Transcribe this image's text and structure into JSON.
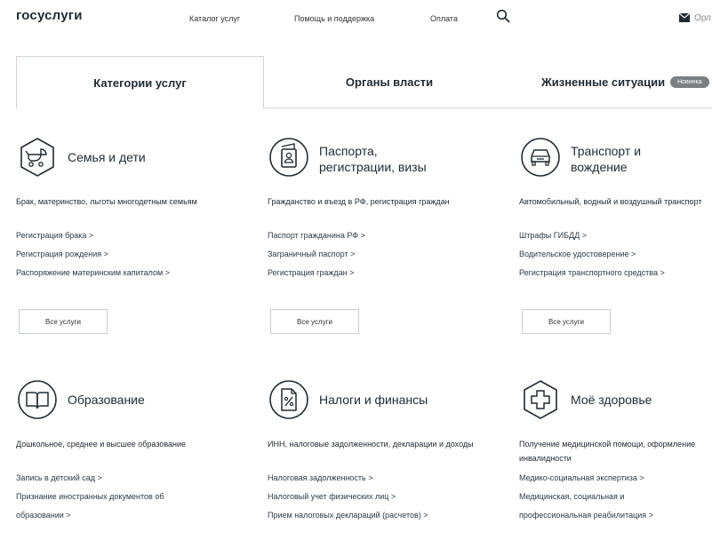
{
  "header": {
    "logo": "госуслуги",
    "nav_catalog": "Каталог услуг",
    "nav_help": "Помощь и поддержка",
    "nav_pay": "Оплата",
    "user_partial": "Орл"
  },
  "tabs": [
    {
      "label": "Категории услуг"
    },
    {
      "label": "Органы власти"
    },
    {
      "label": "Жизненные ситуации",
      "badge": "Новинка"
    }
  ],
  "categories": [
    {
      "title_line1": "Семья и дети",
      "desc": "Брак, материнство, льготы многодетным семьям",
      "links": [
        "Регистрация брака >",
        "Регистрация рождения >",
        "Распоряжение материнским капиталом >"
      ],
      "button": "Все услуги",
      "icon": "stroller-icon"
    },
    {
      "title_line1": "Паспорта,",
      "title_line2": "регистрации, визы",
      "desc": "Гражданство и въезд в РФ, регистрация граждан",
      "links": [
        "Паспорт гражданина РФ >",
        "Заграничный паспорт >",
        "Регистрация граждан >"
      ],
      "button": "Все услуги",
      "icon": "passport-icon"
    },
    {
      "title_line1": "Транспорт и",
      "title_line2": "вождение",
      "desc": "Автомобильный, водный и воздушный транспорт",
      "links": [
        "Штрафы ГИБДД >",
        "Водительское удостоверение >",
        "Регистрация транспортного средства >"
      ],
      "button": "Все услуги",
      "icon": "car-icon"
    },
    {
      "title_line1": "Образование",
      "desc": "Дошкольное, среднее и высшее образование",
      "links": [
        "Запись в детский сад >",
        "Признание иностранных документов об",
        "образовании >"
      ],
      "icon": "book-icon"
    },
    {
      "title_line1": "Налоги и финансы",
      "desc": "ИНН, налоговые задолженности, декларации и доходы",
      "links": [
        "Налоговая задолженность >",
        "Налоговый учет физических лиц >",
        "Прием налоговых деклараций (расчетов) >"
      ],
      "icon": "tax-document-icon"
    },
    {
      "title_line1": "Моё здоровье",
      "desc": "Получение медицинской помощи, оформление инвалидности",
      "links": [
        "Медико-социальная экспертиза >",
        "Медицинская, социальная и",
        "профессиональная реабилитация >"
      ],
      "icon": "medical-cross-icon"
    }
  ]
}
